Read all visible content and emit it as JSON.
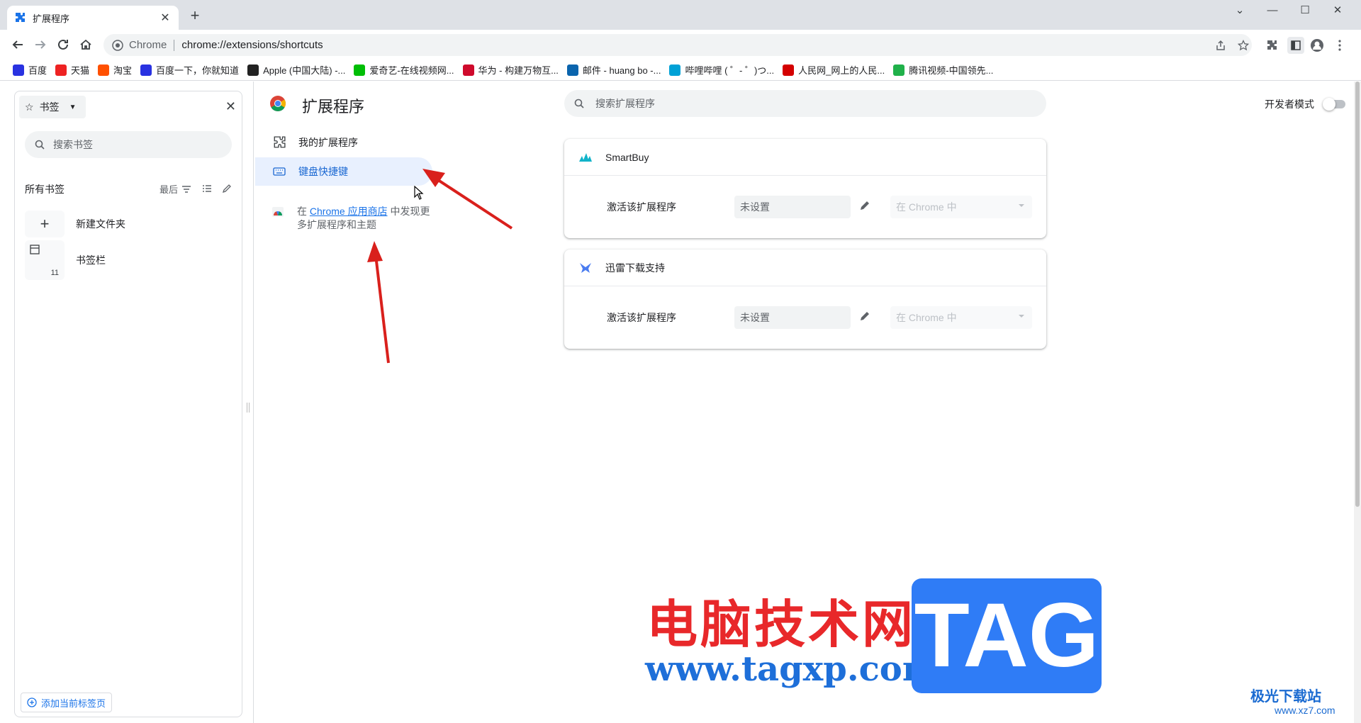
{
  "tab": {
    "title": "扩展程序"
  },
  "toolbar": {
    "site_chip": "Chrome",
    "url": "chrome://extensions/shortcuts"
  },
  "bookmarks_bar": [
    {
      "label": "百度",
      "color": "#2932e1"
    },
    {
      "label": "天猫",
      "color": "#e22"
    },
    {
      "label": "淘宝",
      "color": "#ff5000"
    },
    {
      "label": "百度一下，你就知道",
      "color": "#2932e1"
    },
    {
      "label": "Apple (中国大陆) -...",
      "color": "#222"
    },
    {
      "label": "爱奇艺-在线视频网...",
      "color": "#00be06"
    },
    {
      "label": "华为 - 构建万物互...",
      "color": "#cf0a2c"
    },
    {
      "label": "邮件 - huang bo -...",
      "color": "#0a64ad"
    },
    {
      "label": "哔哩哔哩 ( ゜- ゜)つ...",
      "color": "#00a1d6"
    },
    {
      "label": "人民网_网上的人民...",
      "color": "#d40000"
    },
    {
      "label": "腾讯视频-中国领先...",
      "color": "#20b14a"
    }
  ],
  "side_panel": {
    "selector_label": "书签",
    "search_placeholder": "搜索书签",
    "all_bookmarks": "所有书签",
    "sort_label": "最后",
    "new_folder": "新建文件夹",
    "bookmarks_bar_label": "书签栏",
    "bookmarks_bar_count": "11",
    "add_current_tab": "添加当前标签页"
  },
  "extensions": {
    "page_title": "扩展程序",
    "nav_my_extensions": "我的扩展程序",
    "nav_shortcuts": "键盘快捷键",
    "promo_prefix": "在 ",
    "promo_link": "Chrome 应用商店",
    "promo_suffix": " 中发现更多扩展程序和主题",
    "search_placeholder": "搜索扩展程序",
    "dev_mode_label": "开发者模式",
    "cards": [
      {
        "name": "SmartBuy",
        "row_label": "激活该扩展程序",
        "shortcut": "未设置",
        "scope": "在 Chrome 中"
      },
      {
        "name": "迅雷下载支持",
        "row_label": "激活该扩展程序",
        "shortcut": "未设置",
        "scope": "在 Chrome 中"
      }
    ]
  },
  "watermark": {
    "title": "电脑技术网",
    "url": "www.tagxp.com",
    "badge": "TAG",
    "site": "极光下载站",
    "site_url": "www.xz7.com"
  }
}
